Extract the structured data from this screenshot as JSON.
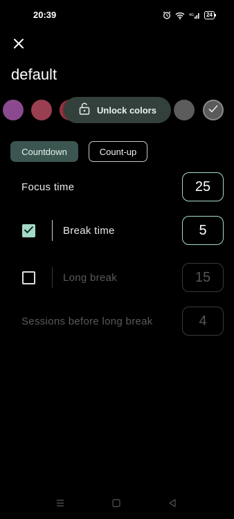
{
  "status_bar": {
    "time": "20:39",
    "battery": "24",
    "icons": [
      "alarm-icon",
      "wifi-icon",
      "signal-icon"
    ]
  },
  "profile": {
    "name": "default"
  },
  "colors": {
    "unlock_label": "Unlock colors",
    "swatches": [
      "#8b4a8f",
      "#9a3e52",
      "#a53a48",
      "#5c5c5c",
      "#5a5a5a"
    ],
    "accent": "#a3d9c6"
  },
  "mode": {
    "countdown_label": "Countdown",
    "countup_label": "Count-up",
    "selected": "Countdown"
  },
  "settings": {
    "focus": {
      "label": "Focus time",
      "value": "25"
    },
    "break": {
      "label": "Break time",
      "value": "5",
      "checked": true
    },
    "long_break": {
      "label": "Long break",
      "value": "15",
      "checked": false
    },
    "sessions": {
      "label": "Sessions before long break",
      "value": "4"
    }
  },
  "nav": {
    "icons": [
      "menu-icon",
      "home-icon",
      "back-icon"
    ]
  }
}
